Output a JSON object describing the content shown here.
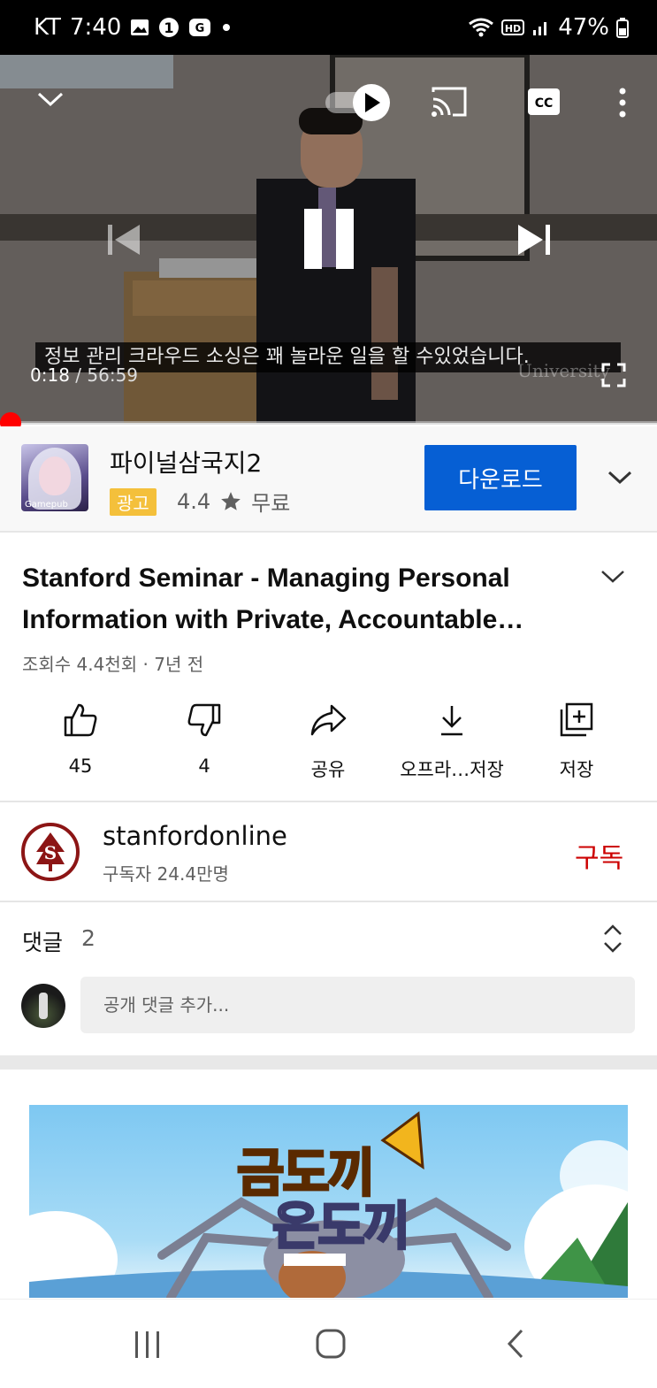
{
  "status_bar": {
    "carrier": "KT",
    "time": "7:40",
    "battery": "47%",
    "icons": [
      "gallery-icon",
      "notification-1-icon",
      "app-icon",
      "dot-icon",
      "wifi-icon",
      "hd-icon",
      "signal-icon",
      "battery-icon"
    ]
  },
  "player": {
    "caption": "정보 관리 크라우드 소싱은 꽤 놀라운 일을 할 수있었습니다.",
    "current_time": "0:18",
    "separator": " / ",
    "duration": "56:59",
    "watermark": "University",
    "progress_fraction": 0.005,
    "autoplay": "on",
    "icons": [
      "collapse-chevron-icon",
      "autoplay-toggle-icon",
      "cast-icon",
      "captions-icon",
      "more-vert-icon",
      "previous-icon",
      "pause-icon",
      "next-icon",
      "fullscreen-icon"
    ]
  },
  "ad": {
    "app_name": "파이널삼국지2",
    "badge": "광고",
    "rating": "4.4",
    "price": "무료",
    "cta": "다운로드",
    "thumb_text": "Gamepub"
  },
  "video": {
    "title": "Stanford Seminar - Managing Personal Information with Private, Accountable…",
    "meta": "조회수 4.4천회 · 7년 전"
  },
  "actions": [
    {
      "label": "45",
      "icon": "like-icon"
    },
    {
      "label": "4",
      "icon": "dislike-icon"
    },
    {
      "label": "공유",
      "icon": "share-icon"
    },
    {
      "label": "오프라…저장",
      "icon": "download-icon"
    },
    {
      "label": "저장",
      "icon": "save-playlist-icon"
    }
  ],
  "channel": {
    "name": "stanfordonline",
    "subscribers": "구독자 24.4만명",
    "subscribe": "구독"
  },
  "comments": {
    "label": "댓글",
    "count": "2",
    "placeholder": "공개 댓글 추가..."
  },
  "game_ad": {
    "title_line1": "금도끼",
    "title_line2": "은도끼"
  },
  "colors": {
    "accent_red": "#ff0000",
    "cta_blue": "#065fd4",
    "subscribe_red": "#cc0000",
    "ad_badge": "#f4c03b"
  }
}
